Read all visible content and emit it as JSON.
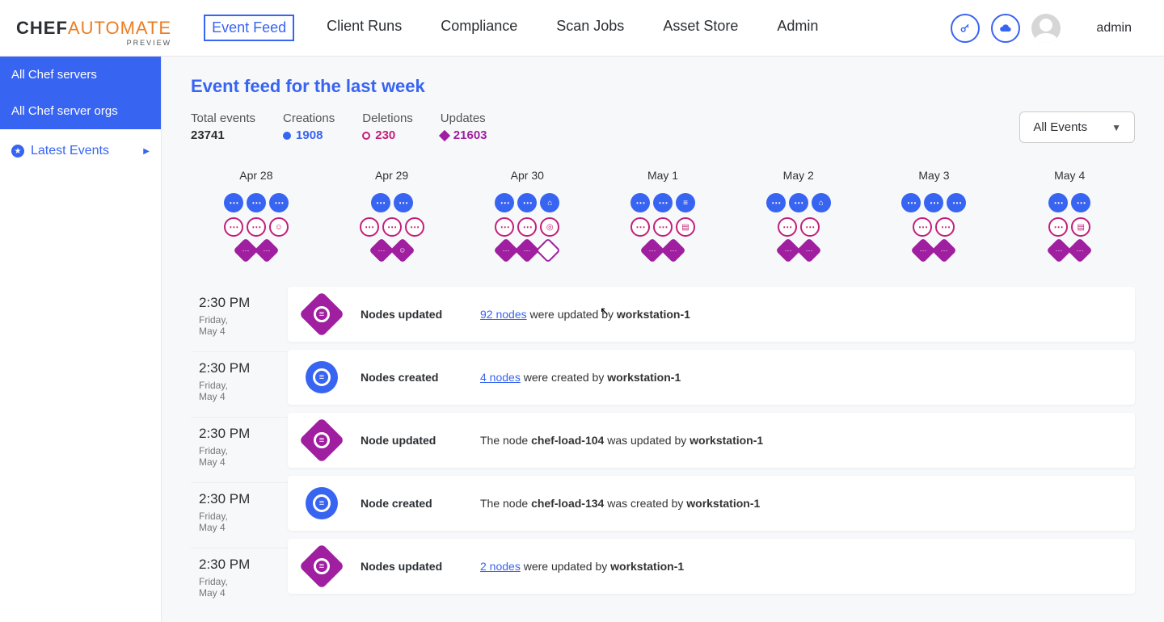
{
  "header": {
    "logo_chef": "CHEF",
    "logo_auto": "AUTOMATE",
    "logo_preview": "PREVIEW",
    "nav": [
      "Event Feed",
      "Client Runs",
      "Compliance",
      "Scan Jobs",
      "Asset Store",
      "Admin"
    ],
    "active_nav": "Event Feed",
    "username": "admin"
  },
  "sidebar": {
    "items": [
      "All Chef servers",
      "All Chef server orgs"
    ],
    "latest_events": "Latest Events"
  },
  "page": {
    "title": "Event feed for the last week",
    "stats": {
      "total_label": "Total events",
      "total_value": "23741",
      "creations_label": "Creations",
      "creations_value": "1908",
      "deletions_label": "Deletions",
      "deletions_value": "230",
      "updates_label": "Updates",
      "updates_value": "21603"
    },
    "filter_dropdown": "All Events",
    "days": [
      "Apr 28",
      "Apr 29",
      "Apr 30",
      "May 1",
      "May 2",
      "May 3",
      "May 4"
    ]
  },
  "colors": {
    "primary": "#3864f2",
    "creations": "#3864f2",
    "deletions": "#c21f7a",
    "updates": "#a01fa0",
    "orange": "#ec7d22"
  },
  "feed": {
    "times": [
      {
        "time": "2:30 PM",
        "day": "Friday,",
        "date": "May 4"
      },
      {
        "time": "2:30 PM",
        "day": "Friday,",
        "date": "May 4"
      },
      {
        "time": "2:30 PM",
        "day": "Friday,",
        "date": "May 4"
      },
      {
        "time": "2:30 PM",
        "day": "Friday,",
        "date": "May 4"
      },
      {
        "time": "2:30 PM",
        "day": "Friday,",
        "date": "May 4"
      }
    ],
    "events": [
      {
        "type": "updated-multi",
        "title": "Nodes updated",
        "link": "92 nodes",
        "tail": " were updated by ",
        "actor": "workstation-1"
      },
      {
        "type": "created-multi",
        "title": "Nodes created",
        "link": "4 nodes",
        "tail": " were created by ",
        "actor": "workstation-1"
      },
      {
        "type": "updated-single",
        "title": "Node updated",
        "pre": "The node ",
        "node": "chef-load-104",
        "tail": " was updated by ",
        "actor": "workstation-1"
      },
      {
        "type": "created-single",
        "title": "Node created",
        "pre": "The node ",
        "node": "chef-load-134",
        "tail": " was created by ",
        "actor": "workstation-1"
      },
      {
        "type": "updated-multi",
        "title": "Nodes updated",
        "link": "2 nodes",
        "tail": " were updated by ",
        "actor": "workstation-1"
      }
    ]
  }
}
